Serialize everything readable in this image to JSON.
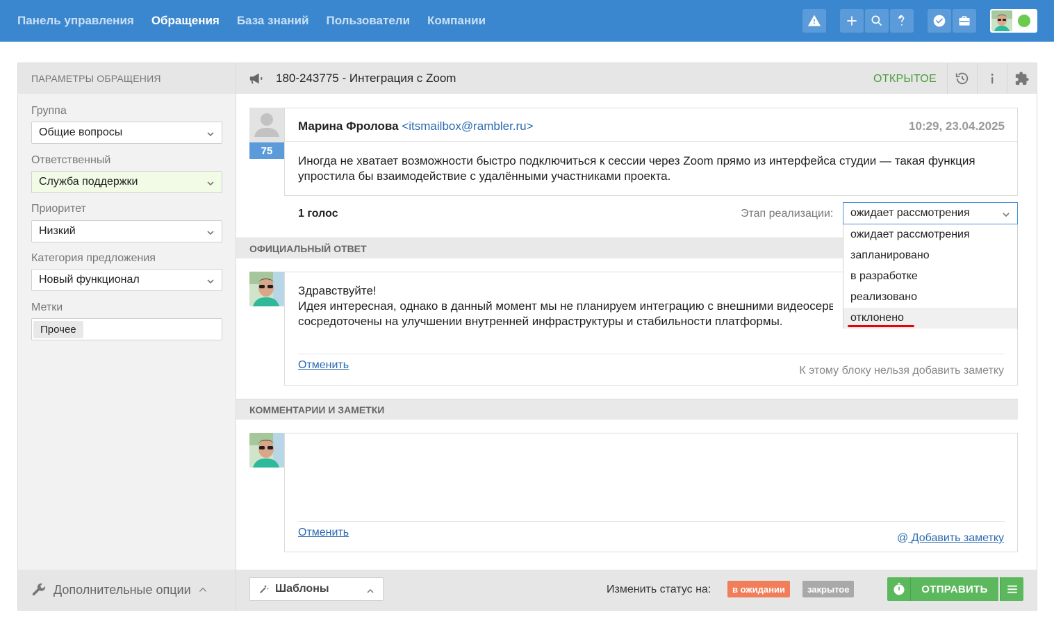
{
  "nav": {
    "items": [
      {
        "label": "Панель управления",
        "active": false
      },
      {
        "label": "Обращения",
        "active": true
      },
      {
        "label": "База знаний",
        "active": false
      },
      {
        "label": "Пользователи",
        "active": false
      },
      {
        "label": "Компании",
        "active": false
      }
    ],
    "icons": [
      "warning-icon",
      "plus-icon",
      "search-icon",
      "help-icon",
      "shield-check-icon",
      "briefcase-icon"
    ],
    "user_status": "online"
  },
  "sidebar": {
    "header": "ПАРАМЕТРЫ ОБРАЩЕНИЯ",
    "fields": {
      "group": {
        "label": "Группа",
        "value": "Общие вопросы"
      },
      "assignee": {
        "label": "Ответственный",
        "value": "Служба поддержки"
      },
      "priority": {
        "label": "Приоритет",
        "value": "Низкий"
      },
      "category": {
        "label": "Категория предложения",
        "value": "Новый функционал"
      },
      "tags": {
        "label": "Метки",
        "values": [
          "Прочее"
        ]
      }
    },
    "footer": "Дополнительные опции"
  },
  "ticket": {
    "title": "180-243775 - Интеграция с Zoom",
    "status": "ОТКРЫТОЕ",
    "message": {
      "author": "Марина Фролова",
      "email": "<itsmailbox@rambler.ru>",
      "date": "10:29, 23.04.2025",
      "votes": "75",
      "text": "Иногда не хватает возможности быстро подключиться к сессии через Zoom прямо из интерфейса студии — такая функция упростила бы взаимодействие с удалёнными участниками проекта."
    },
    "vote_count": "1 голос",
    "stage": {
      "label": "Этап реализации:",
      "selected": "ожидает рассмотрения",
      "options": [
        "ожидает рассмотрения",
        "запланировано",
        "в разработке",
        "реализовано",
        "отклонено"
      ]
    }
  },
  "official_reply": {
    "header": "ОФИЦИАЛЬНЫЙ ОТВЕТ",
    "line1": "Здравствуйте!",
    "line2": "Идея интересная, однако в данный момент мы не планируем интеграцию с внешними видеосервисами. Сейчас мы",
    "line3": "сосредоточены на улучшении внутренней инфраструктуры и стабильности платформы.",
    "cancel": "Отменить",
    "note_info": "К этому блоку нельзя добавить заметку"
  },
  "comments": {
    "header": "КОММЕНТАРИИ И ЗАМЕТКИ",
    "cancel": "Отменить",
    "add_note": "Добавить заметку"
  },
  "footer": {
    "templates": "Шаблоны",
    "change_status": "Изменить статус на:",
    "status_wait": "в ожидании",
    "status_closed": "закрытое",
    "send": "ОТПРАВИТЬ"
  },
  "colors": {
    "topbar": "#3b87cf",
    "status_open": "#4a9d3a",
    "send": "#5cb85c",
    "badge_wait": "#f07e5a",
    "badge_closed": "#a9a9a9",
    "link": "#2a6ab0"
  }
}
